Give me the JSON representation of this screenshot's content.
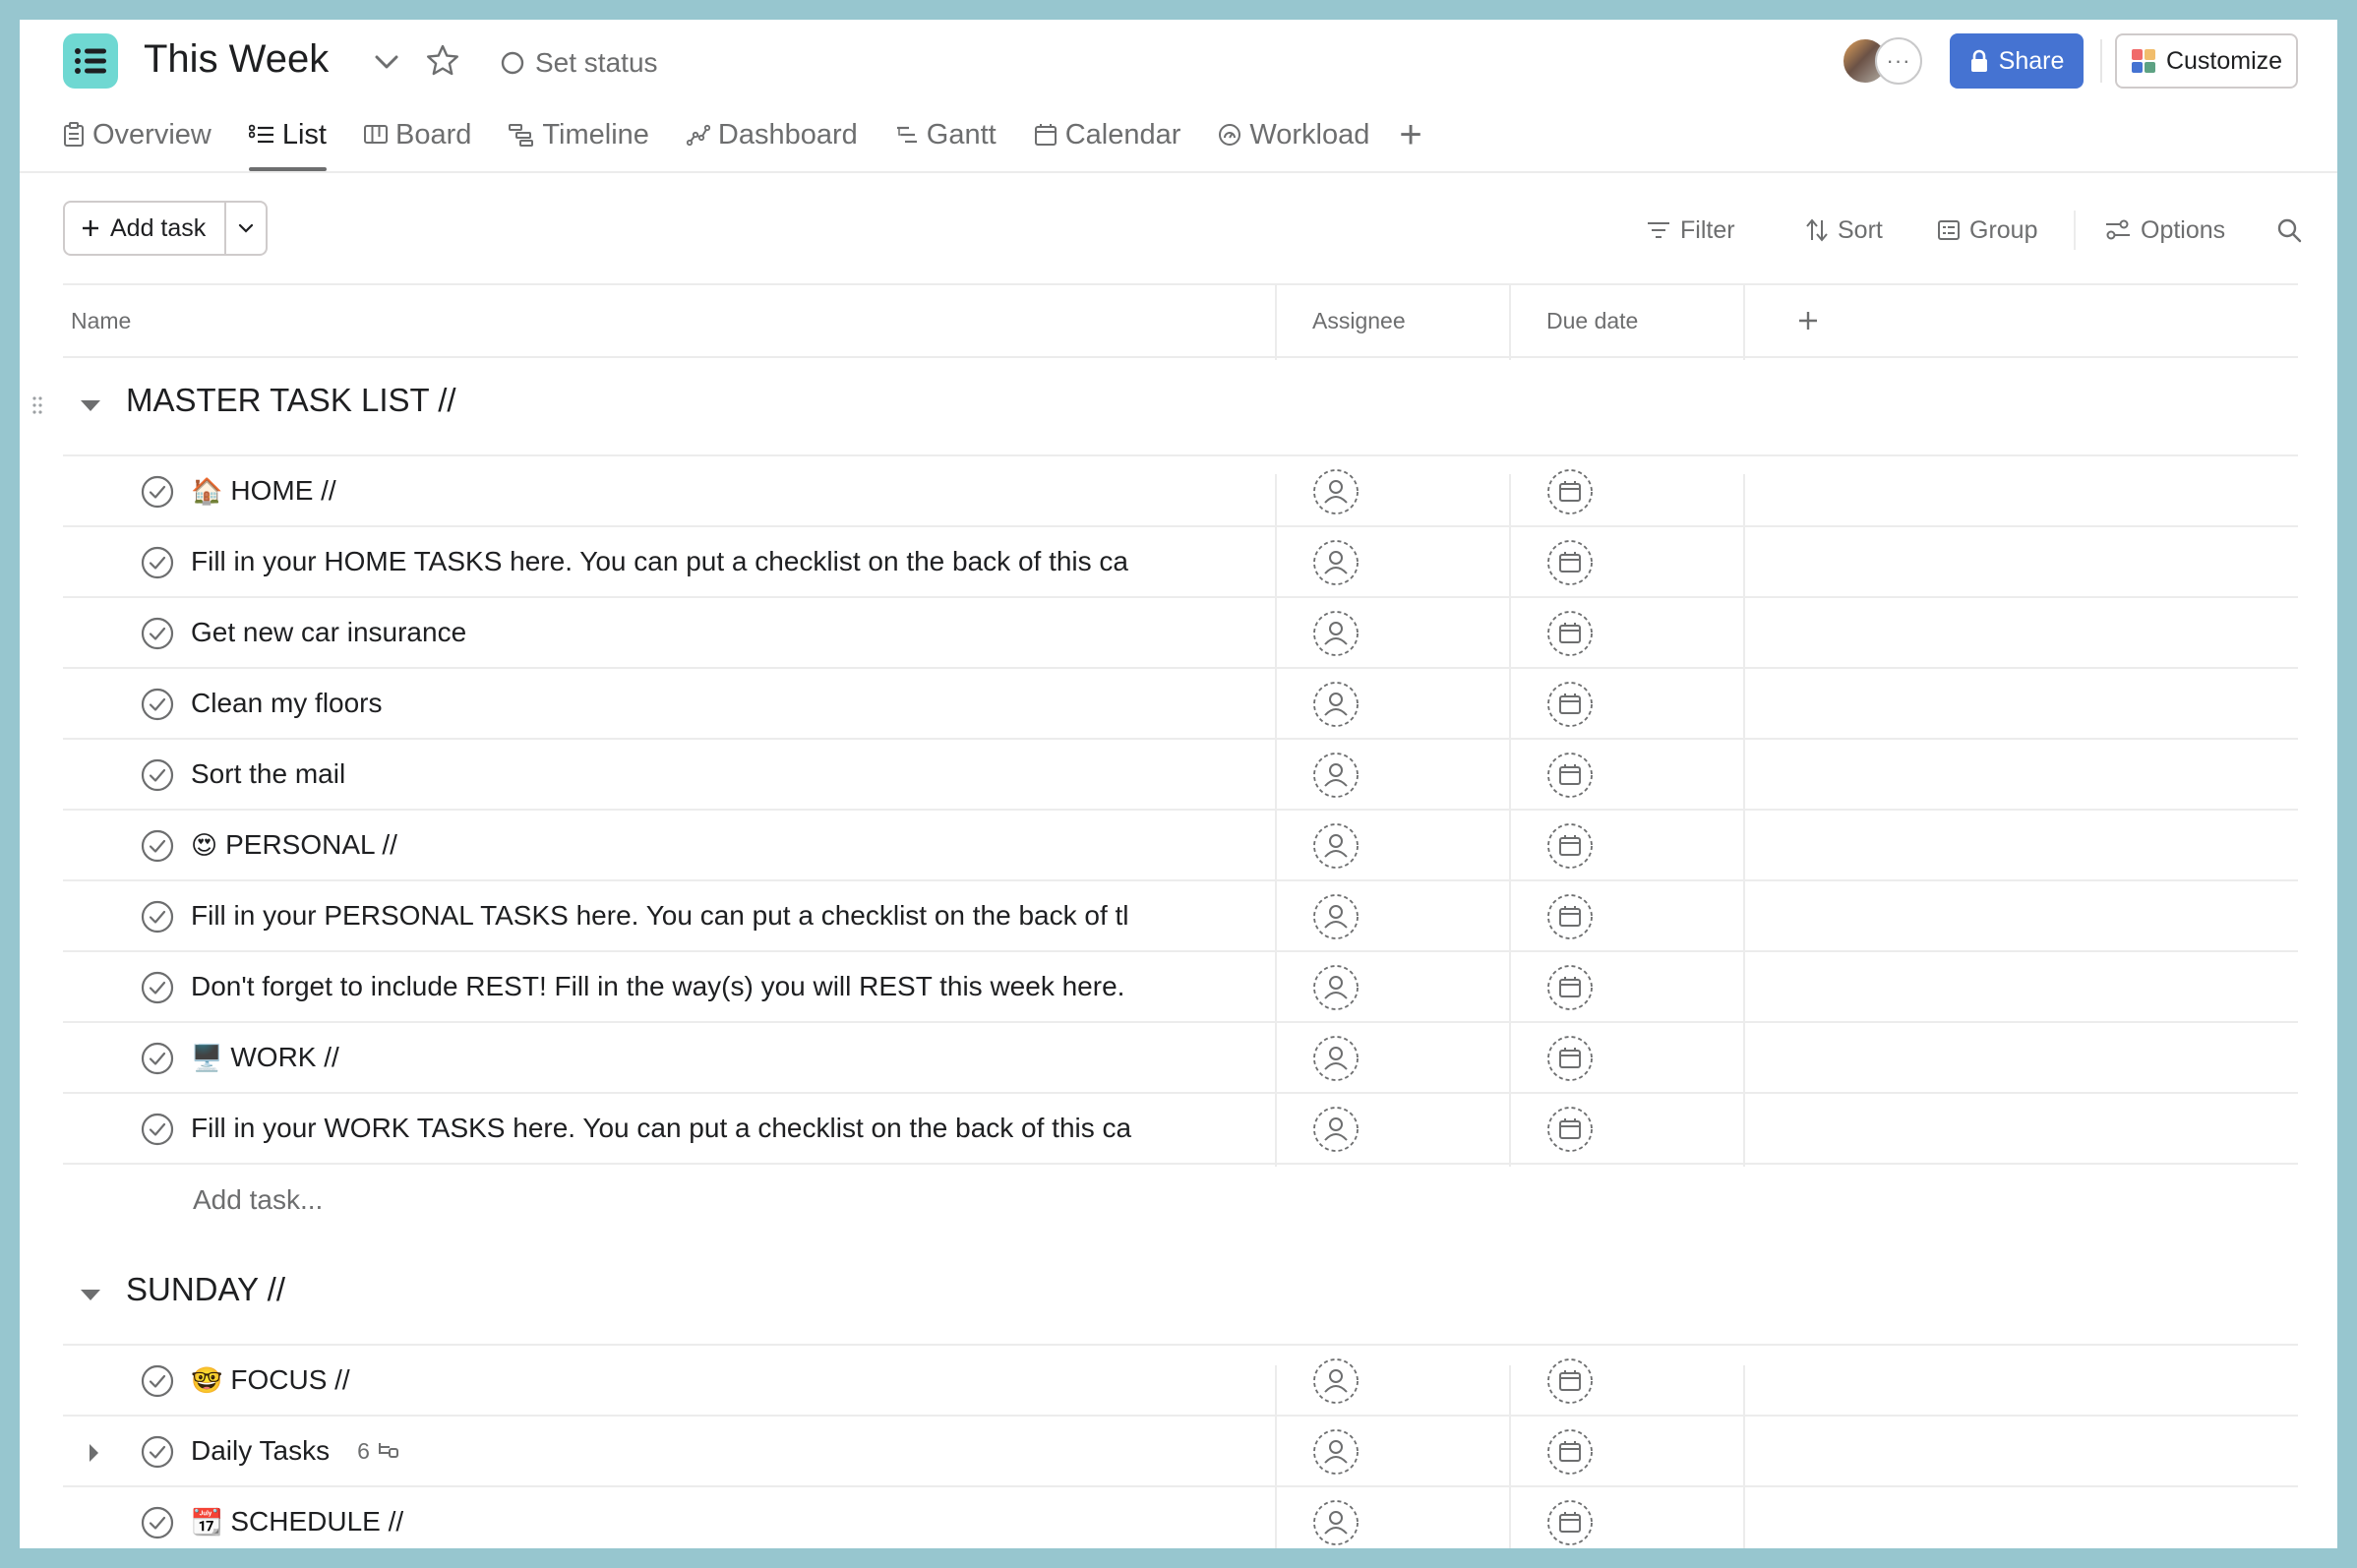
{
  "header": {
    "project_title": "This Week",
    "set_status": "Set status",
    "share": "Share",
    "customize": "Customize",
    "avatar_more": "···"
  },
  "tabs": [
    {
      "label": "Overview",
      "icon": "overview-icon",
      "active": false
    },
    {
      "label": "List",
      "icon": "list-icon",
      "active": true
    },
    {
      "label": "Board",
      "icon": "board-icon",
      "active": false
    },
    {
      "label": "Timeline",
      "icon": "timeline-icon",
      "active": false
    },
    {
      "label": "Dashboard",
      "icon": "dashboard-icon",
      "active": false
    },
    {
      "label": "Gantt",
      "icon": "gantt-icon",
      "active": false
    },
    {
      "label": "Calendar",
      "icon": "calendar-icon",
      "active": false
    },
    {
      "label": "Workload",
      "icon": "workload-icon",
      "active": false
    }
  ],
  "toolbar": {
    "add_task": "Add task",
    "filter": "Filter",
    "sort": "Sort",
    "group": "Group",
    "options": "Options"
  },
  "columns": {
    "name": "Name",
    "assignee": "Assignee",
    "due_date": "Due date"
  },
  "sections": [
    {
      "title": "MASTER TASK LIST //",
      "tasks": [
        {
          "emoji": "🏠",
          "text": "HOME //"
        },
        {
          "emoji": "",
          "text": "Fill in your HOME TASKS here. You can put a checklist on the back of this ca"
        },
        {
          "emoji": "",
          "text": "Get new car insurance"
        },
        {
          "emoji": "",
          "text": "Clean my floors"
        },
        {
          "emoji": "",
          "text": "Sort the mail"
        },
        {
          "emoji": "😍",
          "text": "PERSONAL //"
        },
        {
          "emoji": "",
          "text": "Fill in your PERSONAL TASKS here. You can put a checklist on the back of tl"
        },
        {
          "emoji": "",
          "text": "Don't forget to include REST! Fill in the way(s) you will REST this week here."
        },
        {
          "emoji": "🖥️",
          "text": "WORK //"
        },
        {
          "emoji": "",
          "text": "Fill in your WORK TASKS here. You can put a checklist on the back of this ca"
        }
      ],
      "add_task": "Add task..."
    },
    {
      "title": "SUNDAY //",
      "tasks": [
        {
          "emoji": "🤓",
          "text": "FOCUS //"
        },
        {
          "emoji": "",
          "text": "Daily Tasks",
          "subtask_count": "6"
        },
        {
          "emoji": "📆",
          "text": "SCHEDULE //"
        }
      ]
    }
  ],
  "colors": {
    "accent": "#4573d2",
    "project_icon": "#6fd8d2",
    "frame_border": "#97c6cf"
  }
}
